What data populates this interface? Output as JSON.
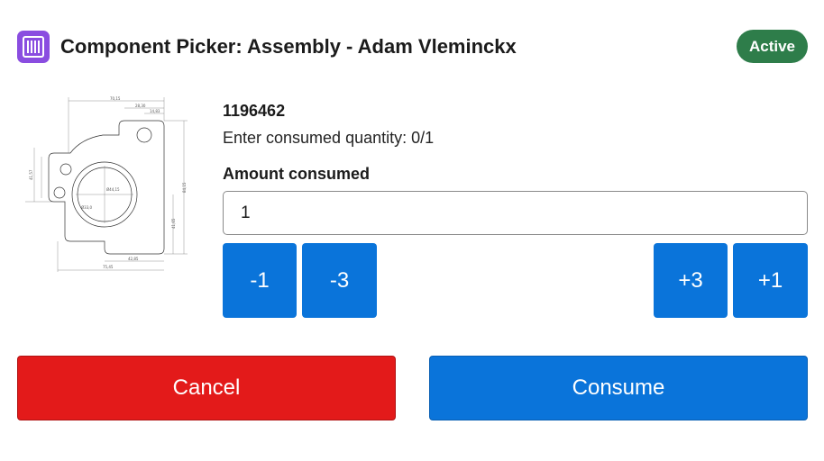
{
  "header": {
    "icon": "barcode-icon",
    "title": "Component Picker: Assembly - Adam Vleminckx",
    "status": "Active",
    "status_color": "#2e7d4a",
    "icon_color": "#8a4de0"
  },
  "part": {
    "image": "technical-drawing",
    "number": "1196462",
    "instruction": "Enter consumed quantity: 0/1"
  },
  "amount": {
    "label": "Amount consumed",
    "value": "1"
  },
  "steppers": {
    "minus1": "-1",
    "minus3": "-3",
    "plus3": "+3",
    "plus1": "+1"
  },
  "actions": {
    "cancel": "Cancel",
    "consume": "Consume",
    "cancel_color": "#e31a1a",
    "consume_color": "#0a74da"
  }
}
